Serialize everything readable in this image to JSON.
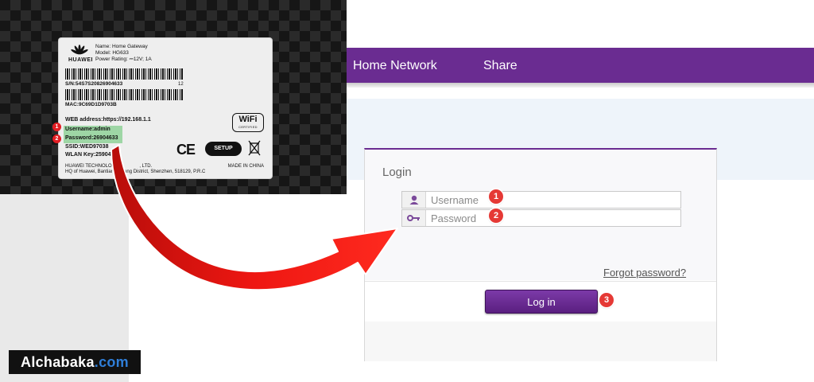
{
  "router_label": {
    "brand": "HUAWEI",
    "name_line": "Name: Home Gateway",
    "model_line": "Model: HG633",
    "power_line": "Power Rating: ⎓12V; 1A",
    "serial": "S/N:54S7S20826904633",
    "serial_suffix": "12",
    "mac": "MAC:9C69D1D9703B",
    "web_address": "WEB address:https://192.168.1.1",
    "username": "Username:admin",
    "password": "Password:26904633",
    "ssid": "SSID:WED97038",
    "wlan_key": "WLAN Key:259046",
    "manufacturer_line1": "HUAWEI TECHNOLOG",
    "manufacturer_line1b": ", LTD.",
    "manufacturer_line2": "HQ of Huawei, Bantian,",
    "manufacturer_line2b": "gang District, Shenzhen, 518129, P.R.C",
    "made_in": "MADE IN CHINA",
    "wifi_logo": "WiFi",
    "wifi_certified": "CERTIFIED",
    "ce_mark": "CE",
    "wps_label": "SETUP",
    "badges": [
      "1",
      "2"
    ]
  },
  "nav": {
    "items": [
      "Home Network",
      "Share"
    ],
    "accent_color": "#6a2c91"
  },
  "login": {
    "title": "Login",
    "username_placeholder": "Username",
    "password_placeholder": "Password",
    "forgot_link": "Forgot password?",
    "login_button": "Log in",
    "username_icon": "user-icon",
    "password_icon": "key-icon"
  },
  "annotations": {
    "step_username": "1",
    "step_password": "2",
    "step_login": "3",
    "badge_color": "#e53935",
    "arrow_color": "#e8140f"
  },
  "watermark": {
    "name": "Alchabaka",
    "domain": ".com"
  }
}
